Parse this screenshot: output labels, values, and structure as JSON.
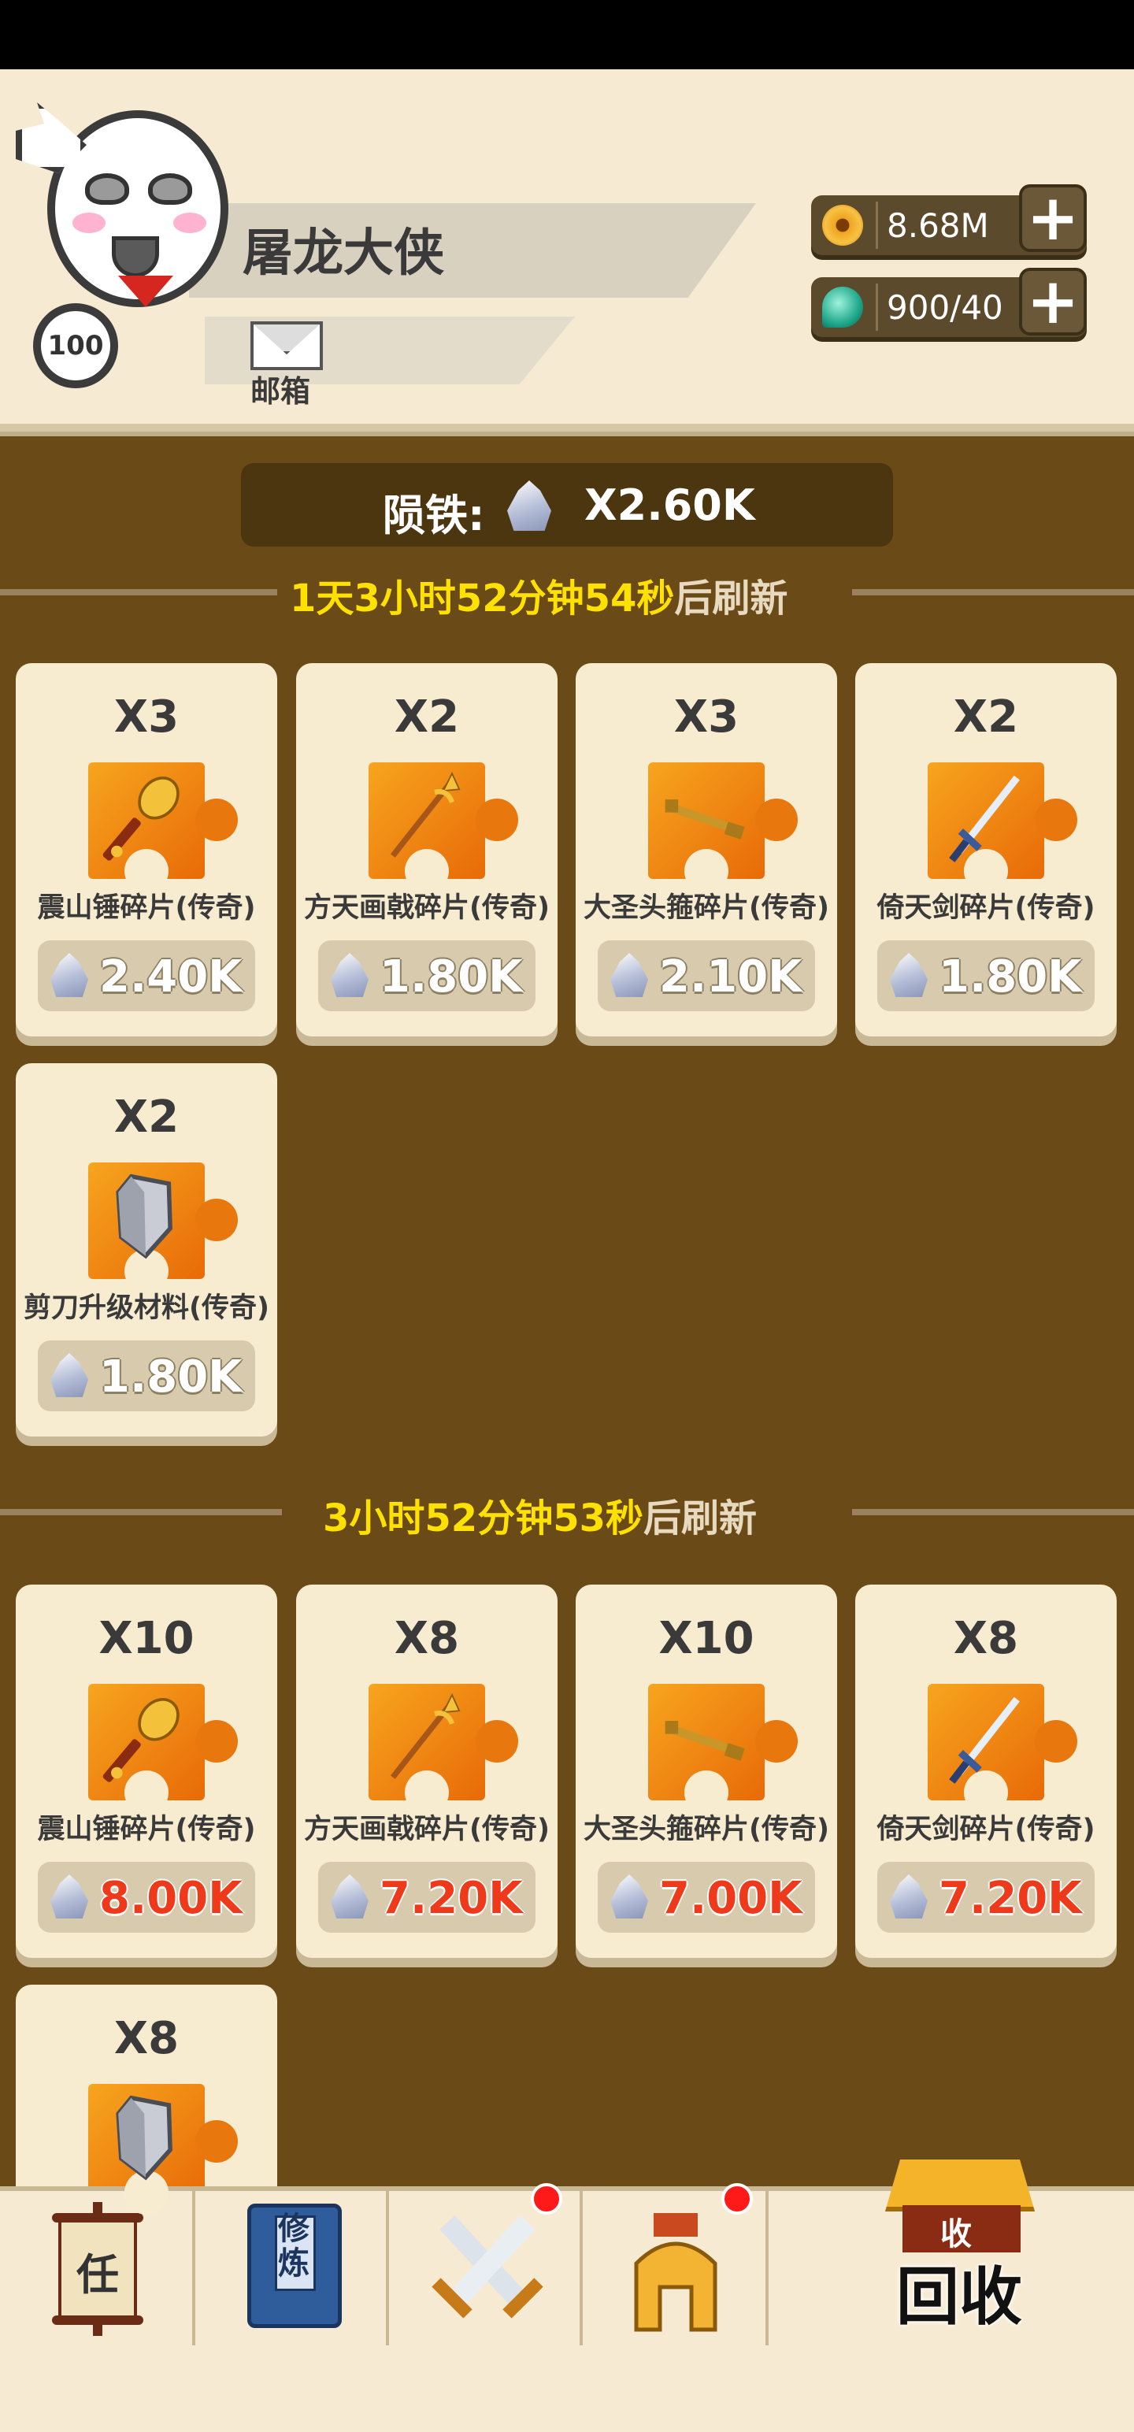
{
  "player": {
    "name": "屠龙大侠",
    "level": "100",
    "mail_label": "邮箱"
  },
  "resources": {
    "gold": {
      "value": "8.68M",
      "icon": "gold-coin-icon"
    },
    "energy": {
      "value": "900/40",
      "icon": "teal-gem-icon"
    }
  },
  "meteor_iron": {
    "label": "陨铁:",
    "value": "X2.60K",
    "icon": "crystal-icon"
  },
  "sections": [
    {
      "timer_highlight": "1天3小时52分钟54秒",
      "timer_rest": "后刷新",
      "items": [
        {
          "qty": "X3",
          "name": "震山锤碎片(传奇)",
          "price": "2.40K",
          "icon": "hammer-icon",
          "price_color": "white"
        },
        {
          "qty": "X2",
          "name": "方天画戟碎片(传奇)",
          "price": "1.80K",
          "icon": "halberd-icon",
          "price_color": "white"
        },
        {
          "qty": "X3",
          "name": "大圣头箍碎片(传奇)",
          "price": "2.10K",
          "icon": "golden-staff-icon",
          "price_color": "white"
        },
        {
          "qty": "X2",
          "name": "倚天剑碎片(传奇)",
          "price": "1.80K",
          "icon": "sword-icon",
          "price_color": "white"
        },
        {
          "qty": "X2",
          "name": "剪刀升级材料(传奇)",
          "price": "1.80K",
          "icon": "blade-stone-icon",
          "price_color": "white"
        }
      ]
    },
    {
      "timer_highlight": "3小时52分钟53秒",
      "timer_rest": "后刷新",
      "items": [
        {
          "qty": "X10",
          "name": "震山锤碎片(传奇)",
          "price": "8.00K",
          "icon": "hammer-icon",
          "price_color": "red"
        },
        {
          "qty": "X8",
          "name": "方天画戟碎片(传奇)",
          "price": "7.20K",
          "icon": "halberd-icon",
          "price_color": "red"
        },
        {
          "qty": "X10",
          "name": "大圣头箍碎片(传奇)",
          "price": "7.00K",
          "icon": "golden-staff-icon",
          "price_color": "red"
        },
        {
          "qty": "X8",
          "name": "倚天剑碎片(传奇)",
          "price": "7.20K",
          "icon": "sword-icon",
          "price_color": "red"
        },
        {
          "qty": "X8",
          "name": "",
          "price": "",
          "icon": "blade-stone-icon",
          "price_color": "red"
        }
      ]
    }
  ],
  "bottom_nav": {
    "task_label": "任",
    "cultivate_label": "修炼",
    "battle_badge": true,
    "equip_badge": true,
    "recycle_label": "回收",
    "recycle_roof_label": "收"
  },
  "colors": {
    "background": "#6a4a16",
    "highlight_timer": "#ffe100",
    "price_red": "#ee3a1a",
    "card_bg": "#f8ecd0"
  }
}
